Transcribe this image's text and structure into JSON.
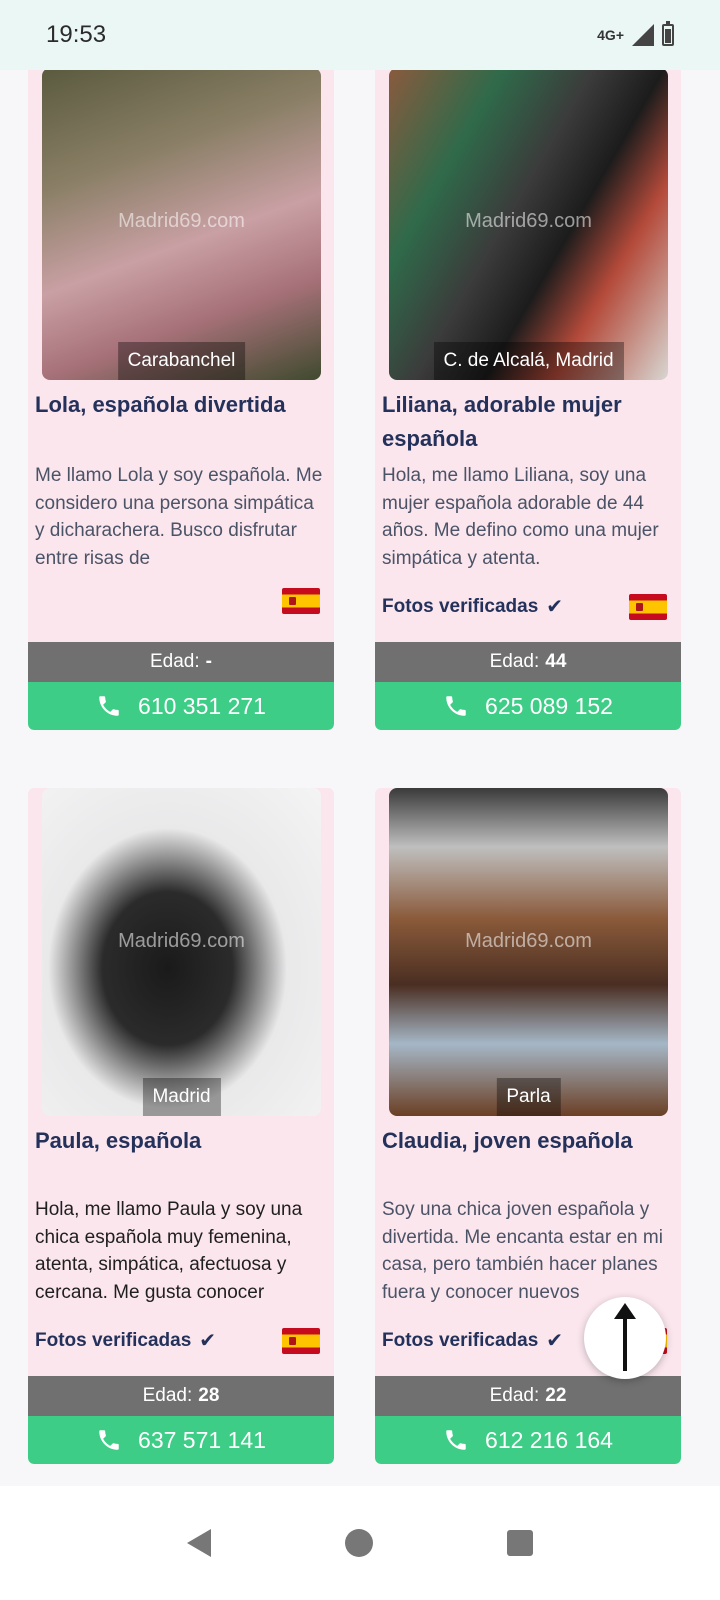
{
  "status_bar": {
    "time": "19:53",
    "network": "4G+"
  },
  "watermark": "Madrid69.com",
  "cards": [
    {
      "location": "Carabanchel",
      "title": "Lola, española divertida",
      "description": "Me llamo Lola y soy española. Me considero una persona simpática y dicharachera. Busco disfrutar entre risas de",
      "verified": "",
      "age_label": "Edad:",
      "age": "-",
      "phone": "610 351 271"
    },
    {
      "location": "C. de Alcalá, Madrid",
      "title": "Liliana, adorable mujer española",
      "description": "Hola, me llamo Liliana, soy una mujer española adorable de 44 años. Me defino como una mujer simpática y atenta.",
      "verified": "Fotos verificadas",
      "age_label": "Edad:",
      "age": "44",
      "phone": "625 089 152"
    },
    {
      "location": "Madrid",
      "title": "Paula, española",
      "description": "Hola, me llamo Paula y soy una chica española muy femenina, atenta, simpática, afectuosa y cercana. Me gusta conocer",
      "verified": "Fotos verificadas",
      "age_label": "Edad:",
      "age": "28",
      "phone": "637 571 141"
    },
    {
      "location": "Parla",
      "title": "Claudia, joven española",
      "description": "Soy una chica joven española y divertida. Me encanta estar en mi casa, pero también hacer planes fuera y conocer nuevos",
      "verified": "Fotos verificadas",
      "age_label": "Edad:",
      "age": "22",
      "phone": "612 216 164"
    }
  ],
  "icons": {
    "phone": "phone-icon",
    "check": "check-icon",
    "flag": "spain-flag-icon",
    "scroll_top": "arrow-up-icon"
  }
}
